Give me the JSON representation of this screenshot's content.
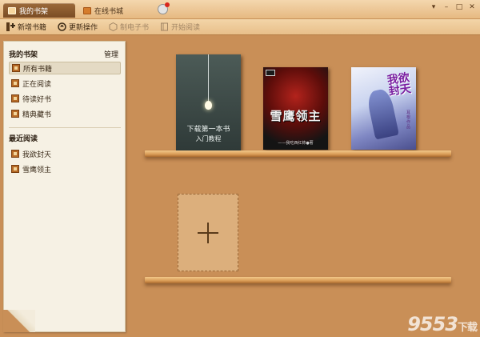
{
  "tabs": [
    {
      "label": "我的书架",
      "active": true
    },
    {
      "label": "在线书城",
      "active": false
    }
  ],
  "window_controls": [
    "▾",
    "–",
    "□",
    "✕"
  ],
  "toolbar": {
    "add_books": "新增书籍",
    "update": "更新操作",
    "make_ebook": "制电子书",
    "start_reading": "开始阅读"
  },
  "sidebar": {
    "my_shelf_title": "我的书架",
    "manage_label": "管理",
    "shelf_items": [
      {
        "label": "所有书籍",
        "selected": true
      },
      {
        "label": "正在阅读",
        "selected": false
      },
      {
        "label": "待读好书",
        "selected": false
      },
      {
        "label": "精典藏书",
        "selected": false
      }
    ],
    "recent_title": "最近阅读",
    "recent_items": [
      {
        "label": "我欲封天"
      },
      {
        "label": "雪鹰领主"
      }
    ]
  },
  "books": {
    "tutorial": {
      "line1": "下载第一本书",
      "line2": "入门教程"
    },
    "xueying": {
      "title": "雪鹰领主",
      "author": "——我吃西红柿●著"
    },
    "woyu": {
      "title": "我欲封天",
      "spine": "耳根作品"
    }
  },
  "add_slot": {
    "symbol": "+"
  },
  "watermark": {
    "main": "9553",
    "suffix": "下载"
  },
  "colors": {
    "wood": "#c98f57",
    "header_gradient_top": "#f4d7ae",
    "active_tab": "#7a4c24",
    "sidebar_bg": "#f6f1e4",
    "shelf": "#d89a54"
  }
}
